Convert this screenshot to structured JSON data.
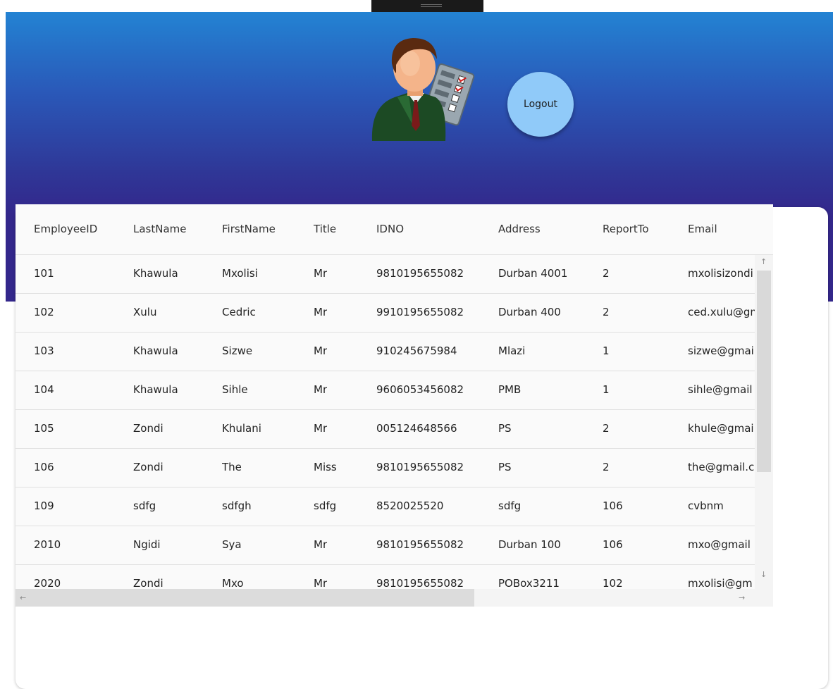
{
  "header": {
    "logout_label": "Logout",
    "avatar_icon": "businessman-checklist-icon",
    "gradient_colors": [
      "#2383d3",
      "#33278b"
    ]
  },
  "table": {
    "columns": [
      "EmployeeID",
      "LastName",
      "FirstName",
      "Title",
      "IDNO",
      "Address",
      "ReportTo",
      "Email"
    ],
    "rows": [
      [
        "101",
        "Khawula",
        "Mxolisi",
        "Mr",
        "9810195655082",
        "Durban 4001",
        "2",
        "mxolisizondi"
      ],
      [
        "102",
        "Xulu",
        "Cedric",
        "Mr",
        "9910195655082",
        "Durban 400",
        "2",
        "ced.xulu@gm"
      ],
      [
        "103",
        "Khawula",
        "Sizwe",
        "Mr",
        "910245675984",
        "Mlazi",
        "1",
        "sizwe@gmail"
      ],
      [
        "104",
        "Khawula",
        "Sihle",
        "Mr",
        "9606053456082",
        "PMB",
        "1",
        "sihle@gmail"
      ],
      [
        "105",
        "Zondi",
        "Khulani",
        "Mr",
        "005124648566",
        "PS",
        "2",
        "khule@gmail"
      ],
      [
        "106",
        "Zondi",
        "The",
        "Miss",
        "9810195655082",
        "PS",
        "2",
        "the@gmail.c"
      ],
      [
        "109",
        "sdfg",
        "sdfgh",
        "sdfg",
        "8520025520",
        "sdfg",
        "106",
        "cvbnm"
      ],
      [
        "2010",
        "Ngidi",
        "Sya",
        "Mr",
        "9810195655082",
        "Durban 100",
        "106",
        "mxo@gmail"
      ],
      [
        "2020",
        "Zondi",
        "Mxo",
        "Mr",
        "9810195655082",
        "POBox3211",
        "102",
        "mxolisi@gm"
      ]
    ]
  },
  "scrollbars": {
    "up_arrow": "↑",
    "down_arrow": "↓",
    "left_arrow": "←",
    "right_arrow": "→"
  }
}
